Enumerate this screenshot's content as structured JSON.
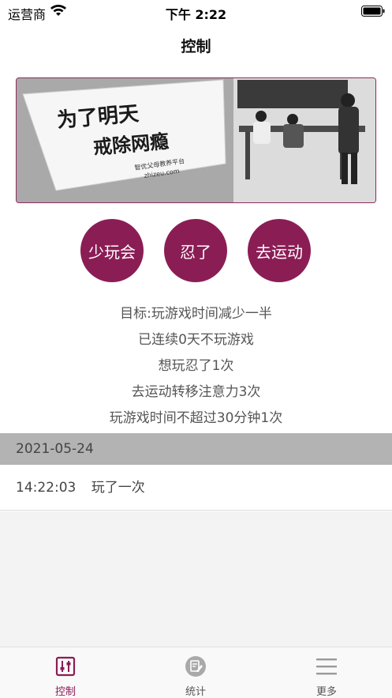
{
  "status_bar": {
    "carrier": "运营商",
    "time": "下午 2:22"
  },
  "nav": {
    "title": "控制"
  },
  "banner": {
    "line1": "为了明天",
    "line2": "戒除网瘾",
    "watermark_cn": "智优父母教养平台",
    "watermark_en": "zhizeu.com"
  },
  "actions": [
    {
      "label": "少玩会"
    },
    {
      "label": "忍了"
    },
    {
      "label": "去运动"
    }
  ],
  "stats": {
    "goal": "目标:玩游戏时间减少一半",
    "streak": "已连续0天不玩游戏",
    "resisted": "想玩忍了1次",
    "exercised": "去运动转移注意力3次",
    "under_limit": "玩游戏时间不超过30分钟1次"
  },
  "records": {
    "date": "2021-05-24",
    "items": [
      {
        "time": "14:22:03",
        "text": "玩了一次"
      }
    ]
  },
  "tabbar": {
    "items": [
      {
        "label": "控制",
        "icon": "sliders-icon",
        "active": true
      },
      {
        "label": "统计",
        "icon": "stats-edit-icon",
        "active": false
      },
      {
        "label": "更多",
        "icon": "menu-icon",
        "active": false
      }
    ]
  },
  "colors": {
    "accent": "#8b1d55",
    "section_header": "#b3b3b3",
    "empty_bg": "#f3f3f3"
  }
}
